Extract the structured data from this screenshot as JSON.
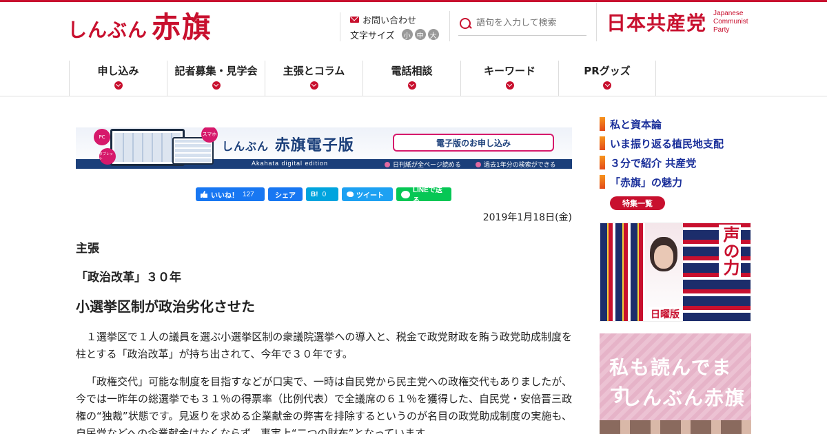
{
  "header": {
    "logo_kana": "しんぶん",
    "logo_kanji": "赤旗",
    "contact": "お問い合わせ",
    "font_size_label": "文字サイズ",
    "font_sizes": [
      "小",
      "中",
      "大"
    ],
    "search_placeholder": "語句を入力して検索",
    "party_name": "日本共産党",
    "party_en_1": "Japanese",
    "party_en_2": "Communist",
    "party_en_3": "Party"
  },
  "nav": [
    {
      "label": "申し込み"
    },
    {
      "label": "記者募集・見学会"
    },
    {
      "label": "主張とコラム"
    },
    {
      "label": "電話相談"
    },
    {
      "label": "キーワード"
    },
    {
      "label": "PRグッズ"
    }
  ],
  "banner": {
    "bubble_pc": "PC",
    "bubble_tablet": "タブレット",
    "bubble_phone": "スマホ",
    "title_kana": "しんぶん",
    "title_main": "赤旗電子版",
    "subtitle": "Akahata digital edition",
    "apply_label": "電子版のお申し込み",
    "feature_1": "日刊紙が全ページ読める",
    "feature_2": "過去1年分の検索ができる"
  },
  "social": {
    "like_label": "いいね！",
    "like_count": "127",
    "share_label": "シェア",
    "hatena_label": "B!",
    "hatena_count": "0",
    "tweet_label": "ツイート",
    "line_label": "LINEで送る"
  },
  "article": {
    "date": "2019年1月18日(金)",
    "kind": "主張",
    "subtitle": "「政治改革」３０年",
    "title": "小選挙区制が政治劣化させた",
    "paragraphs": [
      "１選挙区で１人の議員を選ぶ小選挙区制の衆議院選挙への導入と、税金で政党財政を賄う政党助成制度を柱とする「政治改革」が持ち出されて、今年で３０年です。",
      "「政権交代」可能な制度を目指すなどが口実で、一時は自民党から民主党への政権交代もありましたが、今では一昨年の総選挙でも３１％の得票率（比例代表）で全議席の６１％を獲得した、自民党・安倍晋三政権の“独裁”状態です。見返りを求める企業献金の弊害を排除するというのが名目の政党助成制度の実施も、自民党などへの企業献金はなくならず、事実上“二つの財布”となっています。"
    ]
  },
  "sidebar": {
    "links": [
      {
        "label": "私と資本論"
      },
      {
        "label": "いま振り返る植民地支配"
      },
      {
        "label": "３分で紹介 共産党"
      },
      {
        "label": "「赤旗」の魅力"
      }
    ],
    "special_list": "特集一覧",
    "promo1_voice": "声の力",
    "promo1_edition": "日曜版",
    "promo2_line1": "私も読んでます",
    "promo2_line2": "しんぶん赤旗"
  },
  "colors": {
    "brand_red": "#c8102e",
    "link_blue": "#1a2f9a",
    "banner_navy": "#1b3f7a"
  }
}
